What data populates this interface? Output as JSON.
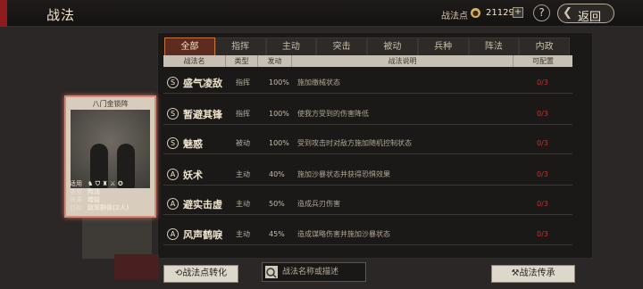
{
  "header": {
    "title": "战法",
    "points_label": "战法点",
    "points_value": "21129",
    "plus": "+",
    "help": "?",
    "back_label": "返回"
  },
  "tabs": [
    "全部",
    "指挥",
    "主动",
    "突击",
    "被动",
    "兵种",
    "阵法",
    "内政"
  ],
  "columns": [
    "战法名",
    "类型",
    "发动",
    "战法说明",
    "可配置"
  ],
  "rows": [
    {
      "grade": "S",
      "name": "盛气凌敌",
      "type": "指挥",
      "rate": "100%",
      "desc": "施加缴械状态",
      "slot": "0/3"
    },
    {
      "grade": "S",
      "name": "暂避其锋",
      "type": "指挥",
      "rate": "100%",
      "desc": "使我方受到的伤害降低",
      "slot": "0/3"
    },
    {
      "grade": "S",
      "name": "魅惑",
      "type": "被动",
      "rate": "100%",
      "desc": "受到攻击时对敌方施加随机控制状态",
      "slot": "0/3"
    },
    {
      "grade": "A",
      "name": "妖术",
      "type": "主动",
      "rate": "40%",
      "desc": "施加沙暴状态并获得恐惧效果",
      "slot": "0/3"
    },
    {
      "grade": "A",
      "name": "避实击虚",
      "type": "主动",
      "rate": "50%",
      "desc": "造成兵刃伤害",
      "slot": "0/3"
    },
    {
      "grade": "A",
      "name": "风声鹤唳",
      "type": "主动",
      "rate": "45%",
      "desc": "造成谋略伤害并施加沙暴状态",
      "slot": "0/3"
    }
  ],
  "card": {
    "title": "八门金锁阵",
    "info": [
      {
        "k": "适用",
        "v": ""
      },
      {
        "k": "类型",
        "v": "阵法"
      },
      {
        "k": "效果",
        "v": "增益"
      },
      {
        "k": "目标",
        "v": "敌军群体(2人)"
      }
    ]
  },
  "buttons": {
    "convert": "战法点转化",
    "search_placeholder": "战法名称或描述",
    "legacy": "战法传承"
  },
  "colors": {
    "active_tab": "#5e2b20",
    "slot_red": "#c1342d",
    "accent": "#8e1c1c"
  }
}
